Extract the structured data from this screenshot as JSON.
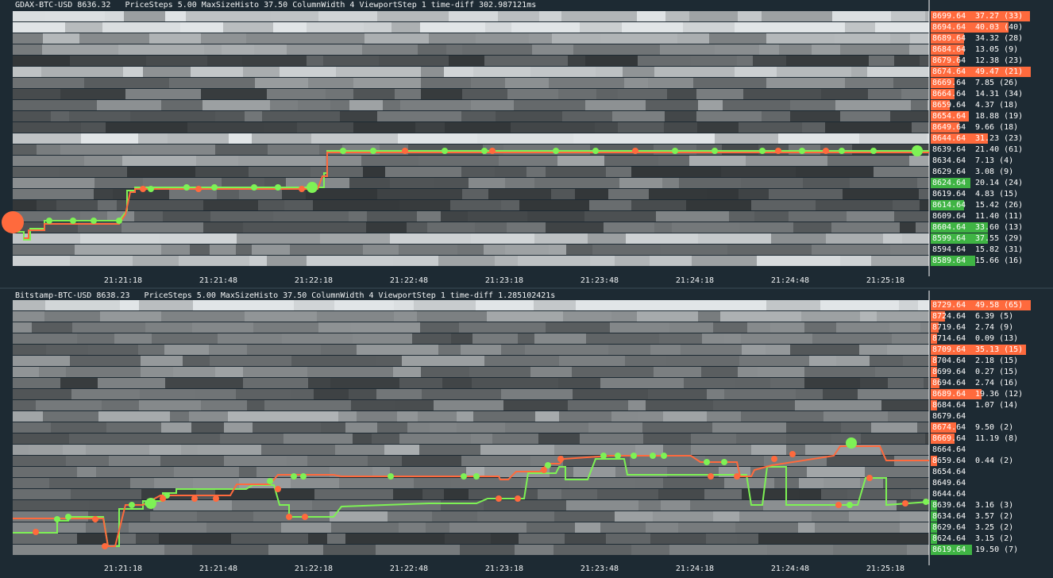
{
  "colors": {
    "background": "#1d2a33",
    "ask": "#ff6a3d",
    "bid": "#3fb444",
    "trade_buy": "#7ef255",
    "trade_sell": "#ff6a3d",
    "vline": "#ffffff"
  },
  "panels": [
    {
      "title": "GDAX-BTC-USD 8636.32   PriceSteps 5.00 MaxSizeHisto 37.50 ColumnWidth 4 ViewportStep 1 time-diff 302.987121ms",
      "ladder": [
        {
          "price": "8699.64",
          "size": "37.27 (33)",
          "side": "ask",
          "fill": 0.99
        },
        {
          "price": "8694.64",
          "size": "40.03 (40)",
          "side": "ask",
          "fill": 0.77
        },
        {
          "price": "8689.64",
          "size": "34.32 (28)",
          "side": "ask",
          "fill": 0.3
        },
        {
          "price": "8684.64",
          "size": "13.05 (9)",
          "side": "ask",
          "fill": 0.3
        },
        {
          "price": "8679.64",
          "size": "12.38 (23)",
          "side": "ask",
          "fill": 0.25
        },
        {
          "price": "8674.64",
          "size": "49.47 (21)",
          "side": "ask",
          "fill": 1.0
        },
        {
          "price": "8669.64",
          "size": "7.85 (26)",
          "side": "ask",
          "fill": 0.2
        },
        {
          "price": "8664.64",
          "size": "14.31 (34)",
          "side": "ask",
          "fill": 0.2
        },
        {
          "price": "8659.64",
          "size": "4.37 (18)",
          "side": "ask",
          "fill": 0.15
        },
        {
          "price": "8654.64",
          "size": "18.88 (19)",
          "side": "ask",
          "fill": 0.35
        },
        {
          "price": "8649.64",
          "size": "9.66 (18)",
          "side": "ask",
          "fill": 0.25
        },
        {
          "price": "8644.64",
          "size": "31.23 (23)",
          "side": "ask",
          "fill": 0.55
        },
        {
          "price": "8639.64",
          "size": "21.40 (61)",
          "side": "none",
          "fill": 0
        },
        {
          "price": "8634.64",
          "size": "7.13 (4)",
          "side": "none",
          "fill": 0
        },
        {
          "price": "8629.64",
          "size": "3.08 (9)",
          "side": "none",
          "fill": 0
        },
        {
          "price": "8624.64",
          "size": "20.14 (24)",
          "side": "bid",
          "fill": 0.37
        },
        {
          "price": "8619.64",
          "size": "4.83 (15)",
          "side": "none",
          "fill": 0
        },
        {
          "price": "8614.64",
          "size": "15.42 (26)",
          "side": "bid",
          "fill": 0.3
        },
        {
          "price": "8609.64",
          "size": "11.40 (11)",
          "side": "none",
          "fill": 0
        },
        {
          "price": "8604.64",
          "size": "33.60 (13)",
          "side": "bid",
          "fill": 0.55
        },
        {
          "price": "8599.64",
          "size": "37.55 (29)",
          "side": "bid",
          "fill": 0.55
        },
        {
          "price": "8594.64",
          "size": "15.82 (31)",
          "side": "none",
          "fill": 0
        },
        {
          "price": "8589.64",
          "size": "15.66 (16)",
          "side": "bid",
          "fill": 0.42
        }
      ],
      "time_ticks": [
        "21:21:18",
        "21:21:48",
        "21:22:18",
        "21:22:48",
        "21:23:18",
        "21:23:48",
        "21:24:18",
        "21:24:48",
        "21:25:18"
      ]
    },
    {
      "title": "Bitstamp-BTC-USD 8638.23   PriceSteps 5.00 MaxSizeHisto 37.50 ColumnWidth 4 ViewportStep 1 time-diff 1.285102421s",
      "ladder": [
        {
          "price": "8729.64",
          "size": "49.58 (65)",
          "side": "ask",
          "fill": 1.0
        },
        {
          "price": "8724.64",
          "size": "6.39 (5)",
          "side": "ask",
          "fill": 0.1
        },
        {
          "price": "8719.64",
          "size": "2.74 (9)",
          "side": "ask",
          "fill": 0.03
        },
        {
          "price": "8714.64",
          "size": "0.09 (13)",
          "side": "ask",
          "fill": 0.02
        },
        {
          "price": "8709.64",
          "size": "35.13 (15)",
          "side": "ask",
          "fill": 0.95
        },
        {
          "price": "8704.64",
          "size": "2.18 (15)",
          "side": "ask",
          "fill": 0.02
        },
        {
          "price": "8699.64",
          "size": "0.27 (15)",
          "side": "ask",
          "fill": 0.02
        },
        {
          "price": "8694.64",
          "size": "2.74 (16)",
          "side": "ask",
          "fill": 0.04
        },
        {
          "price": "8689.64",
          "size": "19.36 (12)",
          "side": "ask",
          "fill": 0.48
        },
        {
          "price": "8684.64",
          "size": "1.07 (14)",
          "side": "ask",
          "fill": 0.02
        },
        {
          "price": "8679.64",
          "size": "",
          "side": "none",
          "fill": 0
        },
        {
          "price": "8674.64",
          "size": "9.50 (2)",
          "side": "ask",
          "fill": 0.22
        },
        {
          "price": "8669.64",
          "size": "11.19 (8)",
          "side": "ask",
          "fill": 0.2
        },
        {
          "price": "8664.64",
          "size": "",
          "side": "none",
          "fill": 0
        },
        {
          "price": "8659.64",
          "size": "0.44 (2)",
          "side": "ask",
          "fill": 0.02
        },
        {
          "price": "8654.64",
          "size": "",
          "side": "none",
          "fill": 0
        },
        {
          "price": "8649.64",
          "size": "",
          "side": "none",
          "fill": 0
        },
        {
          "price": "8644.64",
          "size": "",
          "side": "none",
          "fill": 0
        },
        {
          "price": "8639.64",
          "size": "3.16 (3)",
          "side": "bid",
          "fill": 0.02
        },
        {
          "price": "8634.64",
          "size": "3.57 (2)",
          "side": "bid",
          "fill": 0.02
        },
        {
          "price": "8629.64",
          "size": "3.25 (2)",
          "side": "bid",
          "fill": 0.02
        },
        {
          "price": "8624.64",
          "size": "3.15 (2)",
          "side": "bid",
          "fill": 0.02
        },
        {
          "price": "8619.64",
          "size": "19.50 (7)",
          "side": "bid",
          "fill": 0.38
        }
      ],
      "time_ticks": [
        "21:21:18",
        "21:21:48",
        "21:22:18",
        "21:22:48",
        "21:23:18",
        "21:23:48",
        "21:24:18",
        "21:24:48",
        "21:25:18"
      ]
    }
  ]
}
